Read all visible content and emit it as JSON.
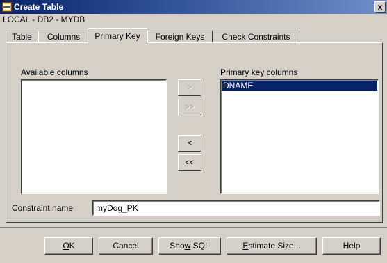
{
  "window": {
    "title": "Create Table",
    "subtitle": "LOCAL - DB2 - MYDB",
    "app_icon": "table-icon",
    "close_glyph": "x"
  },
  "tabs": [
    {
      "label": "Table",
      "active": false
    },
    {
      "label": "Columns",
      "active": false
    },
    {
      "label": "Primary Key",
      "active": true
    },
    {
      "label": "Foreign Keys",
      "active": false
    },
    {
      "label": "Check Constraints",
      "active": false
    }
  ],
  "primary_key": {
    "available_label": "Available columns",
    "available_items": [],
    "selected_label": "Primary key columns",
    "selected_items": [
      "DNAME"
    ],
    "move_buttons": {
      "add": ">",
      "add_all": ">>",
      "remove": "<",
      "remove_all": "<<"
    },
    "constraint_label": "Constraint name",
    "constraint_value": "myDog_PK"
  },
  "buttons": {
    "ok": {
      "pre": "",
      "mn": "O",
      "post": "K"
    },
    "cancel": "Cancel",
    "show_sql": {
      "pre": "Sho",
      "mn": "w",
      "post": " SQL"
    },
    "estimate": {
      "pre": "",
      "mn": "E",
      "post": "stimate Size..."
    },
    "help": "Help"
  }
}
